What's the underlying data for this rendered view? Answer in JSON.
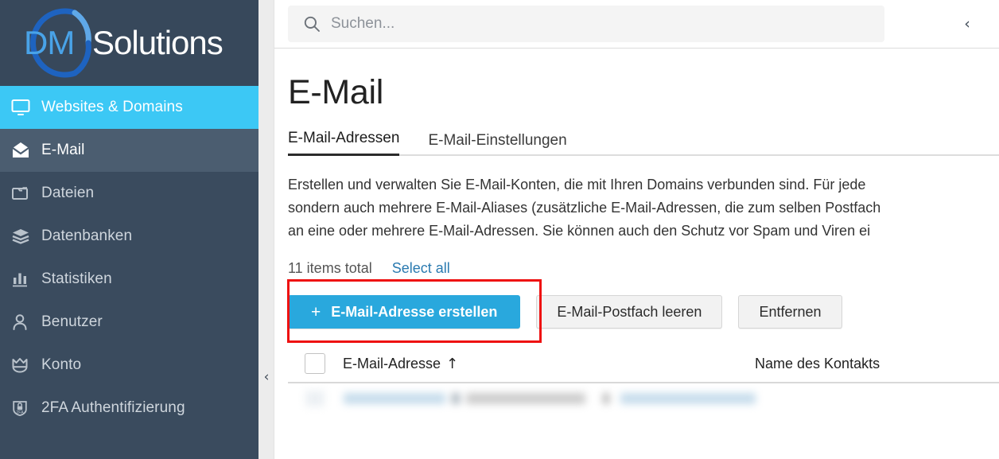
{
  "brand": {
    "logo_text_primary": "DM",
    "logo_text_secondary": "Solutions",
    "accent_blue": "#3cc8f5",
    "sidebar_bg": "#3a4b5e",
    "primary_button_blue": "#29a8dd",
    "highlight_red": "#ee1111",
    "link_blue": "#2a7ab0"
  },
  "sidebar": {
    "items": [
      {
        "label": "Websites & Domains",
        "icon": "monitor-icon",
        "state": "active"
      },
      {
        "label": "E-Mail",
        "icon": "envelope-icon",
        "state": "selected"
      },
      {
        "label": "Dateien",
        "icon": "folder-icon",
        "state": "normal"
      },
      {
        "label": "Datenbanken",
        "icon": "database-stack-icon",
        "state": "normal"
      },
      {
        "label": "Statistiken",
        "icon": "bar-chart-icon",
        "state": "normal"
      },
      {
        "label": "Benutzer",
        "icon": "person-icon",
        "state": "normal"
      },
      {
        "label": "Konto",
        "icon": "crown-icon",
        "state": "normal"
      },
      {
        "label": "2FA Authentifizierung",
        "icon": "shield-2fa-icon",
        "state": "normal"
      }
    ],
    "collapse_chevron": "‹"
  },
  "topbar": {
    "search_placeholder": "Suchen...",
    "search_value": "",
    "search_icon": "search-icon",
    "collapse_chevron": "‹"
  },
  "page": {
    "title": "E-Mail",
    "tabs": [
      {
        "label": "E-Mail-Adressen",
        "active": true
      },
      {
        "label": "E-Mail-Einstellungen",
        "active": false
      }
    ],
    "description_lines": [
      "Erstellen und verwalten Sie E-Mail-Konten, die mit Ihren Domains verbunden sind. Für jede",
      "sondern auch mehrere E-Mail-Aliases (zusätzliche E-Mail-Adressen, die zum selben Postfach",
      "an eine oder mehrere E-Mail-Adressen. Sie können auch den Schutz vor Spam und Viren ei"
    ],
    "items_total": "11 items total",
    "select_all": "Select all"
  },
  "toolbar": {
    "create_button": "E-Mail-Adresse erstellen",
    "create_button_plus": "+",
    "empty_mailbox_button": "E-Mail-Postfach leeren",
    "remove_button": "Entfernen"
  },
  "table": {
    "headers": {
      "email": "E-Mail-Adresse",
      "sort_arrow": "↑",
      "contact_name": "Name des Kontakts"
    }
  }
}
